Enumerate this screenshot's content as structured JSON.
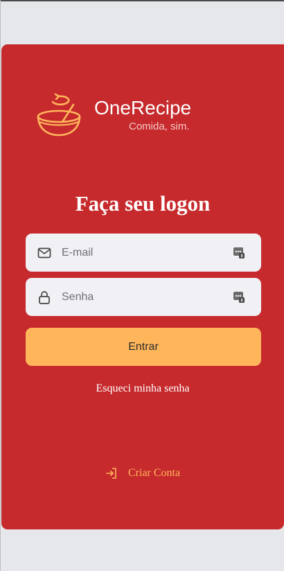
{
  "brand": {
    "name": "OneRecipe",
    "tagline": "Comida, sim."
  },
  "login": {
    "title": "Faça seu logon",
    "email_placeholder": "E-mail",
    "password_placeholder": "Senha",
    "submit_label": "Entrar",
    "forgot_label": "Esqueci minha senha",
    "create_account_label": "Criar Conta"
  },
  "icons": {
    "logo": "bowl-with-spoon-icon",
    "email": "mail-icon",
    "password": "lock-icon",
    "autofill": "password-manager-key-icon",
    "create_account": "sign-in-arrow-icon"
  },
  "colors": {
    "background": "#e6e7eb",
    "card": "#c62a2d",
    "accent": "#ffb65b",
    "field": "#f0f0f5",
    "text_light": "#ffffff"
  }
}
